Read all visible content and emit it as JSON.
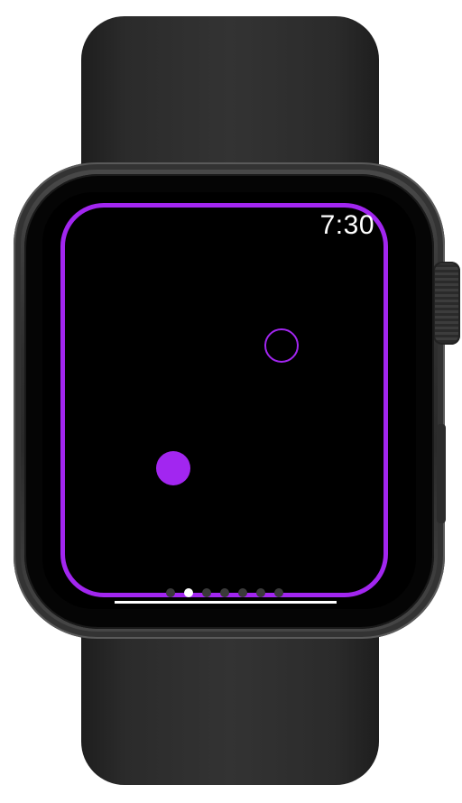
{
  "status_bar": {
    "time": "7:30"
  },
  "game": {
    "accent_color": "#a226f0",
    "elements": {
      "target": "hollow-circle",
      "ball": "filled-circle"
    }
  },
  "pager": {
    "page_count": 7,
    "active_page_index": 1
  }
}
